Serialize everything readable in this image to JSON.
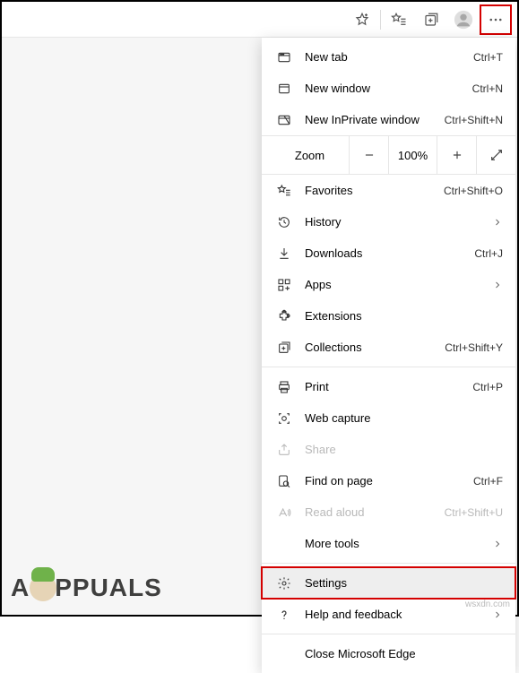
{
  "toolbar": {
    "add_favorite": "Add this page to favorites",
    "favorites": "Favorites",
    "collections": "Collections",
    "profile": "Profile",
    "more": "Settings and more"
  },
  "menu": {
    "new_tab": {
      "label": "New tab",
      "shortcut": "Ctrl+T"
    },
    "new_window": {
      "label": "New window",
      "shortcut": "Ctrl+N"
    },
    "new_inprivate": {
      "label": "New InPrivate window",
      "shortcut": "Ctrl+Shift+N"
    },
    "zoom": {
      "label": "Zoom",
      "value": "100%"
    },
    "favorites": {
      "label": "Favorites",
      "shortcut": "Ctrl+Shift+O"
    },
    "history": {
      "label": "History"
    },
    "downloads": {
      "label": "Downloads",
      "shortcut": "Ctrl+J"
    },
    "apps": {
      "label": "Apps"
    },
    "extensions": {
      "label": "Extensions"
    },
    "collections": {
      "label": "Collections",
      "shortcut": "Ctrl+Shift+Y"
    },
    "print": {
      "label": "Print",
      "shortcut": "Ctrl+P"
    },
    "web_capture": {
      "label": "Web capture"
    },
    "share": {
      "label": "Share"
    },
    "find": {
      "label": "Find on page",
      "shortcut": "Ctrl+F"
    },
    "read_aloud": {
      "label": "Read aloud",
      "shortcut": "Ctrl+Shift+U"
    },
    "more_tools": {
      "label": "More tools"
    },
    "settings": {
      "label": "Settings"
    },
    "help": {
      "label": "Help and feedback"
    },
    "close": {
      "label": "Close Microsoft Edge"
    }
  },
  "brand": "PPUALS",
  "watermark": "wsxdn.com"
}
